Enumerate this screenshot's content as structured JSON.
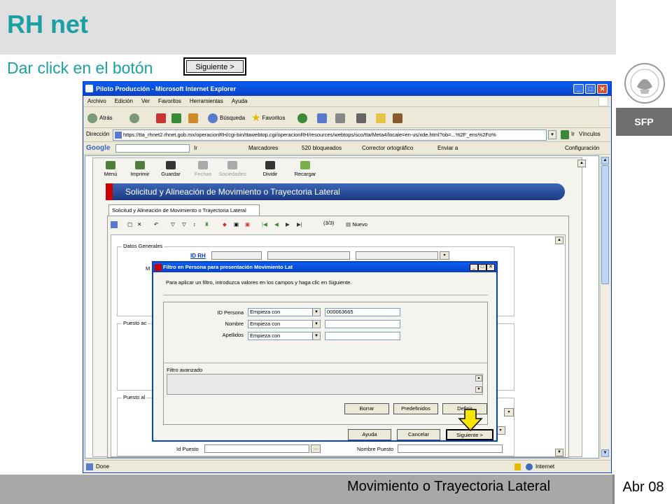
{
  "slide": {
    "title": "RH net",
    "instruction": "Dar click en el botón",
    "button_illustration": "Siguiente >",
    "badge": "SFP",
    "footer_title": "Movimiento o Trayectoria Lateral",
    "footer_date": "Abr 08"
  },
  "browser": {
    "title": "Piloto Producción - Microsoft Internet Explorer",
    "menu": [
      "Archivo",
      "Edición",
      "Ver",
      "Favoritos",
      "Herramientas",
      "Ayuda"
    ],
    "toolbar": {
      "back": "Atrás",
      "search": "Búsqueda",
      "favorites": "Favoritos"
    },
    "address_label": "Dirección",
    "address_url": "https://tta_rhnet2.rhnet.gob.mx/operacionRH/cgi-bin/ttawebtop.cgi/operacionRH/resources/webtops/sco/tta/Meta4/locale=en-us/xde.html?ob=...%2F_ens%2Fo%",
    "go_label": "Ir",
    "links_label": "Vínculos",
    "google": {
      "label": "Google",
      "go": "Ir",
      "bookmarks": "Marcadores",
      "blocked": "520 bloqueados",
      "spell": "Corrector ortográfico",
      "send": "Enviar a",
      "settings": "Configuración"
    },
    "status_done": "Done",
    "status_zone": "Internet"
  },
  "app": {
    "toolbar": [
      "Menú",
      "Imprimir",
      "Guardar",
      "Fechas",
      "Sociedades",
      "Dividir",
      "Recargar"
    ],
    "banner": "Solicitud y Alineación de Movimiento o Trayectoria Lateral",
    "tab": "Solicitud y Alineación de Movimiento o Trayectoria Lateral",
    "record_count": "(3/3)",
    "new_label": "Nuevo",
    "fieldsets": {
      "general": "Datos Generales",
      "puesto_actual": "Puesto ac",
      "puesto_al": "Puesto al"
    },
    "id_rh_label": "ID RH",
    "m_label": "M",
    "id_puesto_label": "Id Puesto",
    "nombre_puesto_label": "Nombre Puesto"
  },
  "dialog": {
    "title": "Filtro en Persona para presentación Movimiento Lat",
    "instruction": "Para aplicar un filtro, introduzca valores en los campos y haga clic en Siguiente.",
    "fields": [
      {
        "label": "ID Persona",
        "operator": "Empieza con",
        "value": "000063665"
      },
      {
        "label": "Nombre",
        "operator": "Empieza con",
        "value": ""
      },
      {
        "label": "Apellidos",
        "operator": "Empieza con",
        "value": ""
      }
    ],
    "advanced_label": "Filtro avanzado",
    "buttons": {
      "clear": "Borrar",
      "predefined": "Predefinidos",
      "define": "Definir",
      "help": "Ayuda",
      "cancel": "Cancelar",
      "next": "Siguiente >"
    }
  },
  "colors": {
    "accent": "#1aa0a4",
    "xp_blue": "#0a5ff0",
    "arrow": "#f5e600"
  }
}
